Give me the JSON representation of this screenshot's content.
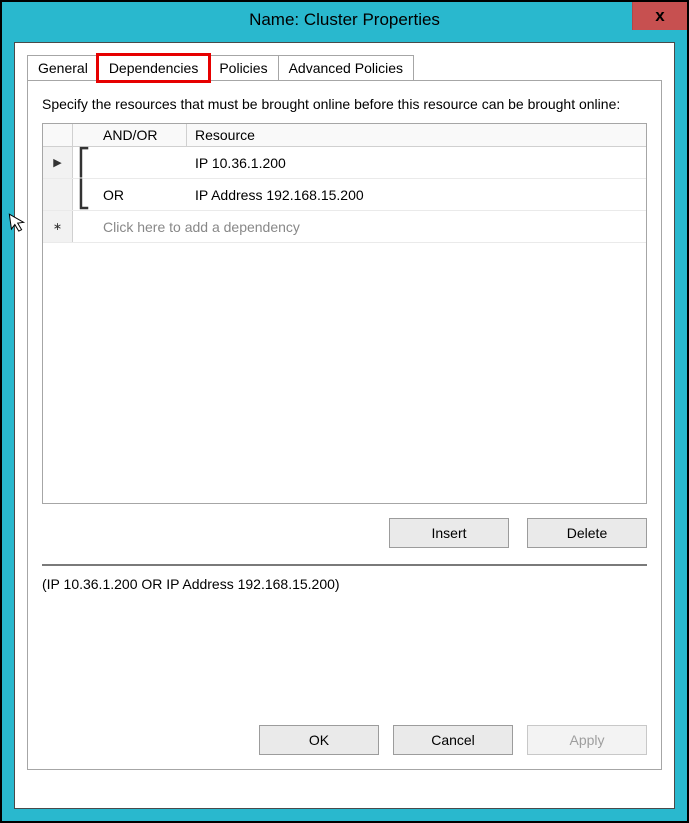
{
  "titlebar": {
    "title": "Name: Cluster Properties",
    "close_glyph": "x"
  },
  "tabs": {
    "general": "General",
    "dependencies": "Dependencies",
    "policies": "Policies",
    "advanced_policies": "Advanced Policies"
  },
  "instructions": "Specify the resources that must be brought online before this resource can be brought online:",
  "grid": {
    "headers": {
      "andor": "AND/OR",
      "resource": "Resource"
    },
    "rows": [
      {
        "selector": "▶",
        "bracket": "⎡",
        "andor": "",
        "resource": "IP 10.36.1.200"
      },
      {
        "selector": "",
        "bracket": "⎣",
        "andor": "OR",
        "resource": "IP Address 192.168.15.200"
      }
    ],
    "add_row": {
      "selector": "∗",
      "placeholder": "Click here to add a dependency"
    }
  },
  "buttons": {
    "insert": "Insert",
    "delete": "Delete",
    "ok": "OK",
    "cancel": "Cancel",
    "apply": "Apply"
  },
  "expression": "(IP 10.36.1.200  OR IP Address 192.168.15.200)"
}
